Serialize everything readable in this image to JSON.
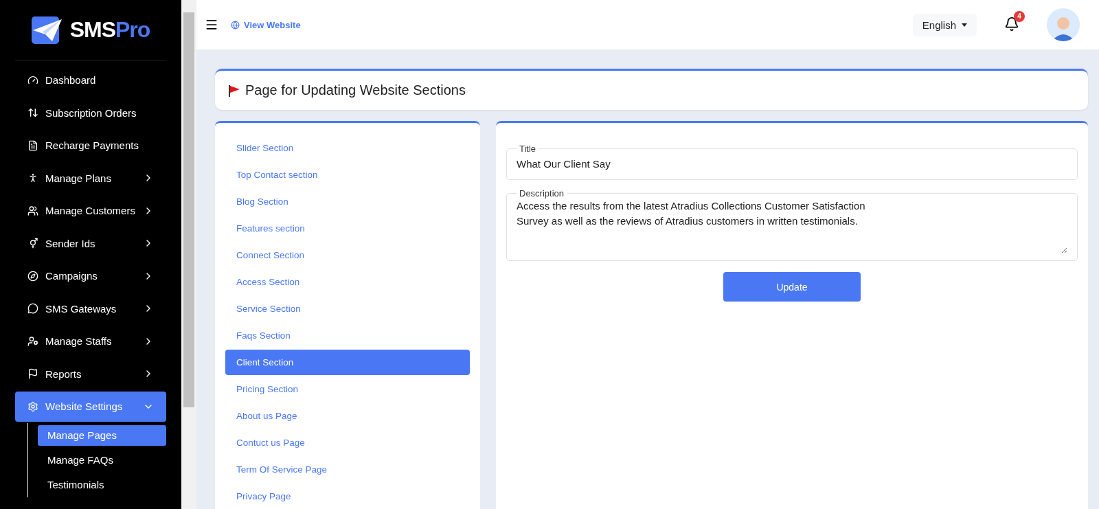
{
  "brand": {
    "name_part_1": "SMS",
    "name_part_2": "Pro"
  },
  "sidebar": {
    "items": [
      {
        "label": "Dashboard",
        "selected": false
      },
      {
        "label": "Subscription Orders",
        "selected": false
      },
      {
        "label": "Recharge Payments",
        "selected": false
      },
      {
        "label": "Manage Plans",
        "expanded": false,
        "selected": false
      },
      {
        "label": "Manage Customers",
        "expanded": false,
        "selected": false
      },
      {
        "label": "Sender Ids",
        "expanded": false,
        "selected": false
      },
      {
        "label": "Campaigns",
        "expanded": false,
        "selected": false
      },
      {
        "label": "SMS Gateways",
        "expanded": false,
        "selected": false
      },
      {
        "label": "Manage Staffs",
        "expanded": false,
        "selected": false
      },
      {
        "label": "Reports",
        "expanded": false,
        "selected": false
      },
      {
        "label": "Website Settings",
        "expanded": true,
        "selected": true,
        "children": [
          {
            "label": "Manage Pages",
            "selected": true
          },
          {
            "label": "Manage FAQs",
            "selected": false
          },
          {
            "label": "Testimonials",
            "selected": false
          }
        ]
      }
    ]
  },
  "topbar": {
    "link": "View Website",
    "language": "English",
    "notifications": "4"
  },
  "page_title": "Page for Updating Website Sections",
  "sections": [
    {
      "label": "Slider Section",
      "selected": false
    },
    {
      "label": "Top Contact section",
      "selected": false
    },
    {
      "label": "Blog Section",
      "selected": false
    },
    {
      "label": "Features section",
      "selected": false
    },
    {
      "label": "Connect Section",
      "selected": false
    },
    {
      "label": "Access Section",
      "selected": false
    },
    {
      "label": "Service Section",
      "selected": false
    },
    {
      "label": "Faqs Section",
      "selected": false
    },
    {
      "label": "Client Section",
      "selected": true
    },
    {
      "label": "Pricing Section",
      "selected": false
    },
    {
      "label": "About us Page",
      "selected": false
    },
    {
      "label": "Contuct us Page",
      "selected": false
    },
    {
      "label": "Term Of Service Page",
      "selected": false
    },
    {
      "label": "Privacy Page",
      "selected": false
    }
  ],
  "form": {
    "title_label": "Title",
    "title_value": "What Our Client Say",
    "description_label": "Description",
    "description_value": "Access the results from the latest Atradius Collections Customer Satisfaction\nSurvey as well as the reviews of Atradius customers in written testimonials.",
    "button": "Update"
  }
}
